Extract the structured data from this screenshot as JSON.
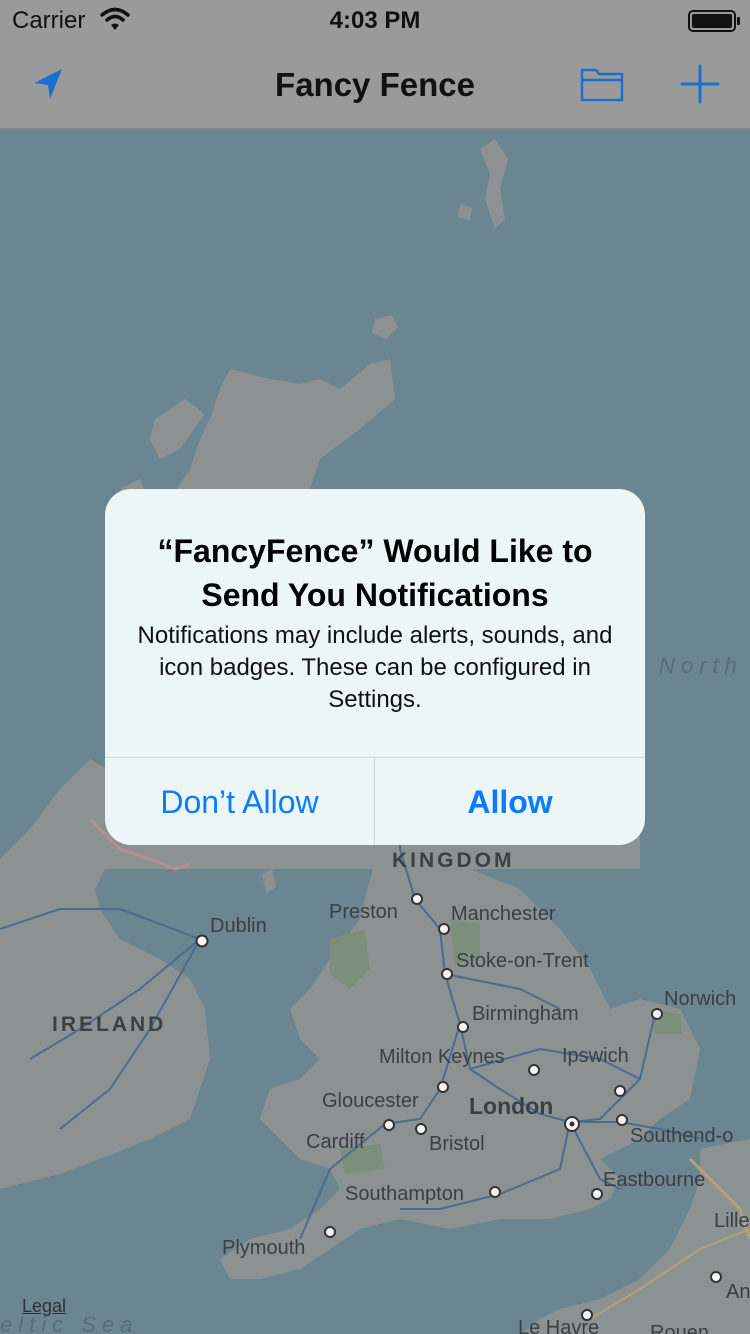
{
  "status_bar": {
    "carrier": "Carrier",
    "time": "4:03 PM"
  },
  "navbar": {
    "title": "Fancy Fence",
    "icons": [
      "location-arrow-icon",
      "folder-icon",
      "plus-icon"
    ],
    "accent": "#1a6fd1"
  },
  "map": {
    "labels": {
      "kingdom": "KINGDOM",
      "ireland": "IRELAND",
      "dublin": "Dublin",
      "preston": "Preston",
      "manchester": "Manchester",
      "stoke": "Stoke-on-Trent",
      "norwich": "Norwich",
      "birmingham": "Birmingham",
      "milton_keynes": "Milton Keynes",
      "ipswich": "Ipswich",
      "gloucester": "Gloucester",
      "london": "London",
      "cardiff": "Cardiff",
      "bristol": "Bristol",
      "southend": "Southend-o",
      "eastbourne": "Eastbourne",
      "southampton": "Southampton",
      "plymouth": "Plymouth",
      "lille": "Lille",
      "le_havre": "Le Havre",
      "amiens": "An",
      "rouen": "Rouen",
      "north_sea": "North",
      "celtic_sea": "eltic Sea"
    },
    "legal": "Legal"
  },
  "alert": {
    "title": "“FancyFence” Would Like to Send You Notifications",
    "message": "Notifications may include alerts, sounds, and icon badges. These can be configured in Settings.",
    "dont_allow": "Don’t Allow",
    "allow": "Allow",
    "button_color": "#0a7cff"
  }
}
